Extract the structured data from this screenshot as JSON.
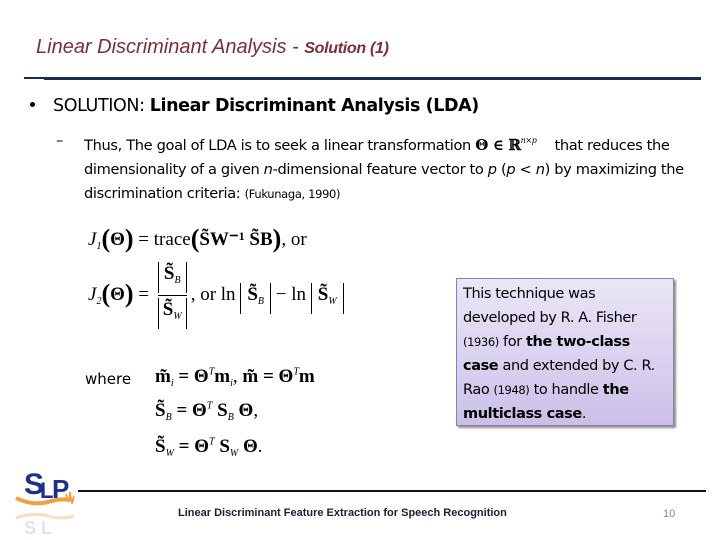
{
  "slide": {
    "title_main": "Linear Discriminant Analysis - ",
    "title_sub": "Solution (1)",
    "colors": {
      "title": "#7a3035",
      "rule": "#1b2a57",
      "note_box": "#d9d0ef"
    }
  },
  "bullet": {
    "lead": "SOLUTION: ",
    "bold": "Linear Discriminant Analysis (LDA)"
  },
  "sub_bullet": {
    "dash": "–",
    "part1": "Thus, The goal of LDA is to seek a linear transformation ",
    "theta": "Θ ∈ ℝ",
    "sup": "n×p",
    "part2": "that reduces the dimensionality of a given ",
    "n_italic": "n",
    "part3": "-dimensional feature vector to ",
    "p_italic": "p",
    "part4": " (",
    "p_italic2": "p",
    "part5": " < ",
    "n_italic2": "n",
    "part6": ") by maximizing the discrimination criteria: ",
    "citation": "(Fukunaga, 1990)"
  },
  "equations": {
    "j1": {
      "lhs": "J",
      "lhs_sub": "1",
      "theta": "Θ",
      "eq": " = trace",
      "body": "S̃W⁻¹ S̃B",
      "tail": ", or"
    },
    "j2": {
      "lhs": "J",
      "lhs_sub": "2",
      "theta": "Θ",
      "eq": " = ",
      "num": "S̃",
      "num_sub": "B",
      "den": "S̃",
      "den_sub": "W",
      "tail": ", or ln",
      "ln_a": "S̃",
      "ln_a_sub": "B",
      "minus": " − ln",
      "ln_b": "S̃",
      "ln_b_sub": "W"
    },
    "where_label": "where",
    "m_line": {
      "lhs": "m̃",
      "lhs_sub": "i",
      "rhs": " = Θ",
      "rhs_sup": "T",
      "rhs2": "m",
      "rhs2_sub": "i",
      "sep": ", ",
      "lhs2": "m̃",
      "rhs3": " = Θ",
      "rhs3_sup": "T",
      "rhs4": "m"
    },
    "sb_line": {
      "lhs": "S̃",
      "lhs_sub": "B",
      "rhs": " = Θ",
      "rhs_sup": "T",
      "mid": "S",
      "mid_sub": "B",
      "end": "Θ",
      "punct": ","
    },
    "sw_line": {
      "lhs": "S̃",
      "lhs_sub": "W",
      "rhs": " = Θ",
      "rhs_sup": "T",
      "mid": "S",
      "mid_sub": "W",
      "end": "Θ",
      "punct": "."
    }
  },
  "note": {
    "t1": "This technique was developed by R. A. Fisher ",
    "y1": "(1936)",
    "t2": " for ",
    "b1": "the two-class case",
    "t3": " and extended by C. R. Rao ",
    "y2": "(1948)",
    "t4": " to handle ",
    "b2": "the multiclass case",
    "t5": "."
  },
  "footer": {
    "logo_text": "SLP",
    "title": "Linear Discriminant Feature Extraction for Speech Recognition",
    "page_number": "10"
  }
}
